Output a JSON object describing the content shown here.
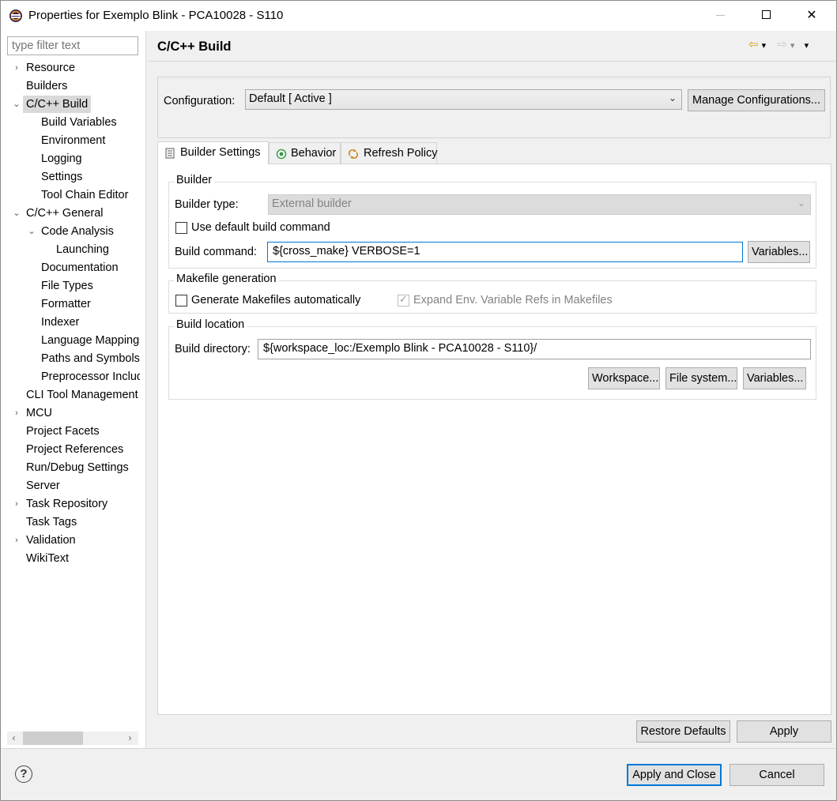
{
  "window": {
    "title": "Properties for Exemplo Blink - PCA10028 - S110",
    "minimize": "—",
    "close": "✕"
  },
  "sidebar": {
    "filter_placeholder": "type filter text",
    "items": [
      {
        "label": "Resource",
        "twisty": "›"
      },
      {
        "label": "Builders",
        "twisty": ""
      },
      {
        "label": "C/C++ Build",
        "twisty": "⌄"
      },
      {
        "label": "Build Variables",
        "twisty": ""
      },
      {
        "label": "Environment",
        "twisty": ""
      },
      {
        "label": "Logging",
        "twisty": ""
      },
      {
        "label": "Settings",
        "twisty": ""
      },
      {
        "label": "Tool Chain Editor",
        "twisty": ""
      },
      {
        "label": "C/C++ General",
        "twisty": "⌄"
      },
      {
        "label": "Code Analysis",
        "twisty": "⌄"
      },
      {
        "label": "Launching",
        "twisty": ""
      },
      {
        "label": "Documentation",
        "twisty": ""
      },
      {
        "label": "File Types",
        "twisty": ""
      },
      {
        "label": "Formatter",
        "twisty": ""
      },
      {
        "label": "Indexer",
        "twisty": ""
      },
      {
        "label": "Language Mappings",
        "twisty": ""
      },
      {
        "label": "Paths and Symbols",
        "twisty": ""
      },
      {
        "label": "Preprocessor Include Paths",
        "twisty": ""
      },
      {
        "label": "CLI Tool Management",
        "twisty": ""
      },
      {
        "label": "MCU",
        "twisty": "›"
      },
      {
        "label": "Project Facets",
        "twisty": ""
      },
      {
        "label": "Project References",
        "twisty": ""
      },
      {
        "label": "Run/Debug Settings",
        "twisty": ""
      },
      {
        "label": "Server",
        "twisty": ""
      },
      {
        "label": "Task Repository",
        "twisty": "›"
      },
      {
        "label": "Task Tags",
        "twisty": ""
      },
      {
        "label": "Validation",
        "twisty": "›"
      },
      {
        "label": "WikiText",
        "twisty": ""
      }
    ],
    "scroll_left": "‹",
    "scroll_right": "›"
  },
  "header": {
    "title": "C/C++ Build",
    "back": "⇦",
    "forward": "⇨",
    "dropdown": "▾"
  },
  "config": {
    "label": "Configuration:",
    "value": "Default  [ Active ]",
    "manage_button": "Manage Configurations..."
  },
  "tabs": [
    {
      "label": "Builder Settings"
    },
    {
      "label": "Behavior"
    },
    {
      "label": "Refresh Policy"
    }
  ],
  "builder": {
    "group_title": "Builder",
    "type_label": "Builder type:",
    "type_value": "External builder",
    "use_default_label": "Use default build command",
    "command_label": "Build command:",
    "command_value": "${cross_make}  VERBOSE=1",
    "variables_button": "Variables..."
  },
  "makefile": {
    "group_title": "Makefile generation",
    "generate_label": "Generate Makefiles automatically",
    "expand_label": "Expand Env. Variable Refs in Makefiles"
  },
  "location": {
    "group_title": "Build location",
    "dir_label": "Build directory:",
    "dir_value": "${workspace_loc:/Exemplo Blink - PCA10028 - S110}/",
    "workspace_button": "Workspace...",
    "filesystem_button": "File system...",
    "variables_button": "Variables..."
  },
  "footer": {
    "restore_defaults": "Restore Defaults",
    "apply": "Apply",
    "apply_close": "Apply and Close",
    "cancel": "Cancel",
    "help": "?"
  },
  "colors": {
    "accent": "#0078d7",
    "selection": "#d9d9d9"
  }
}
